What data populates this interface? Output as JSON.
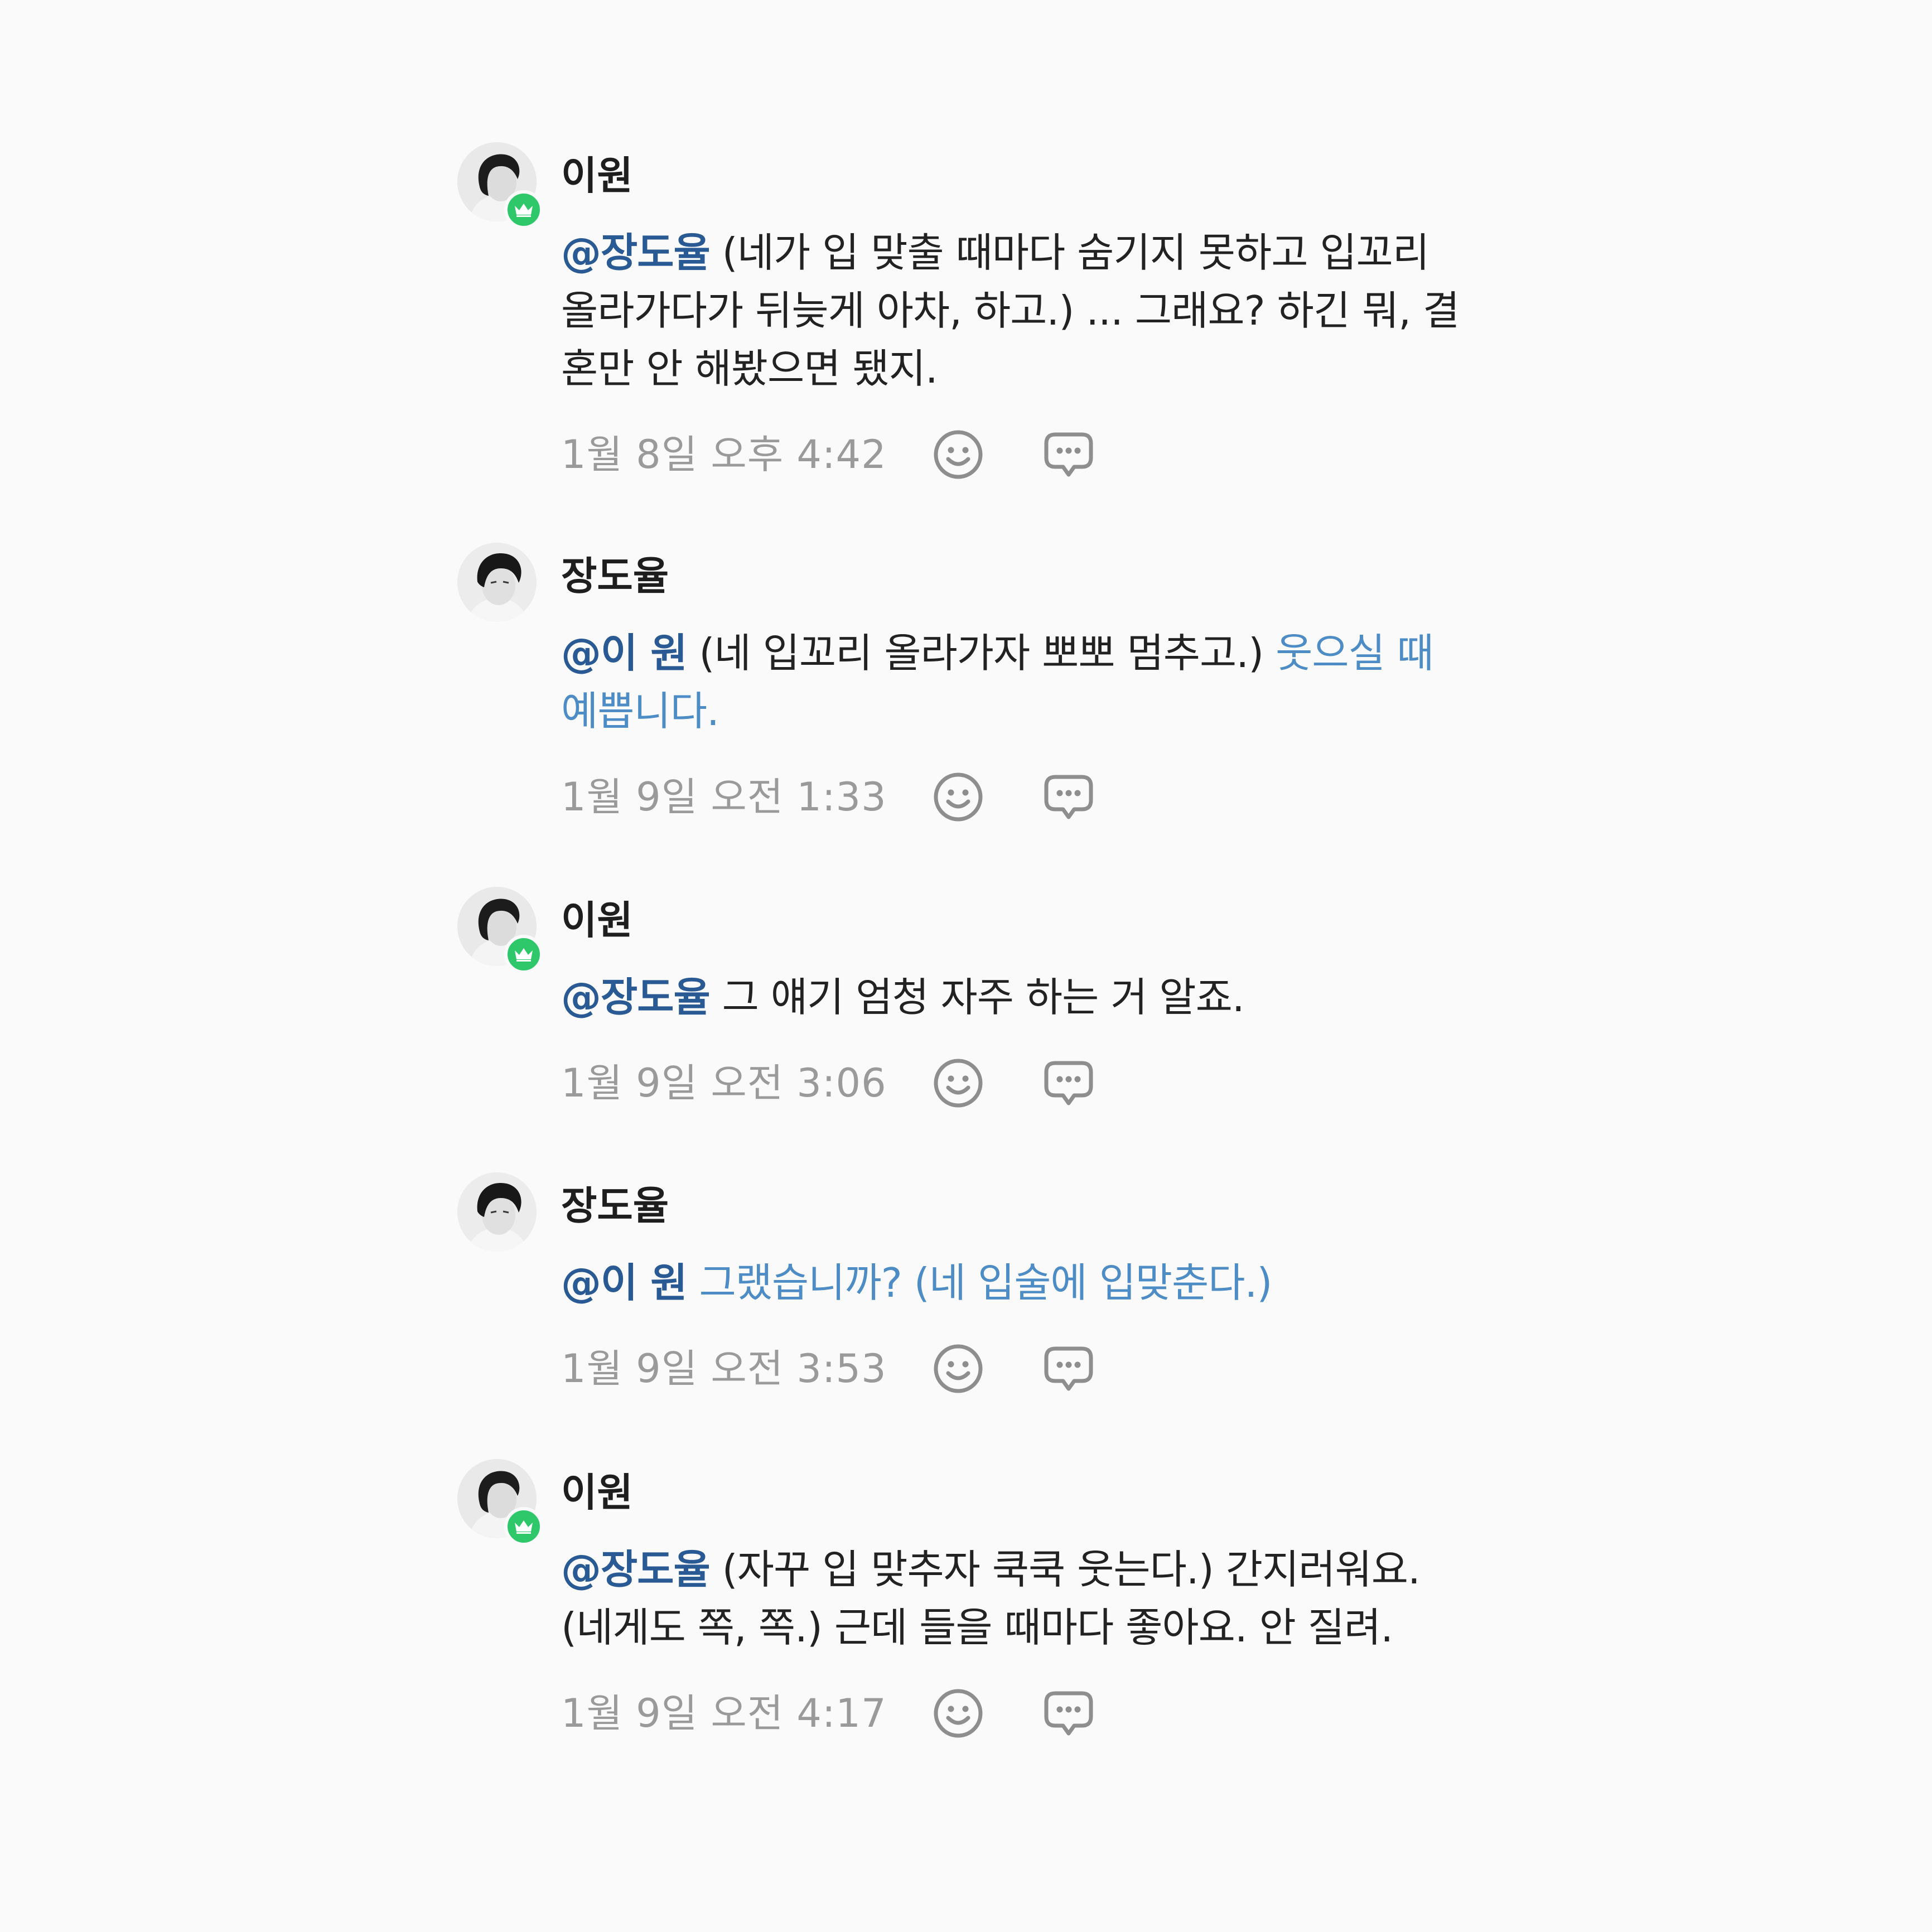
{
  "colors": {
    "background": "#fafafa",
    "mention": "#2a5a94",
    "highlight": "#4d8cc4",
    "timestamp": "#9a9a9a",
    "badge": "#2ec76a"
  },
  "comments": [
    {
      "author": "이원",
      "has_crown_badge": true,
      "mention": "@장도율",
      "text": " (네가 입 맞출 때마다 숨기지 못하고 입꼬리 올라가다가 뒤늦게 아차, 하고.) ... 그래요? 하긴 뭐, 결혼만 안 해봤으면 됐지.",
      "highlight": "",
      "timestamp": "1월 8일 오후 4:42"
    },
    {
      "author": "장도율",
      "has_crown_badge": false,
      "mention": "@이 원",
      "text": " (네 입꼬리 올라가자 뽀뽀 멈추고.) ",
      "highlight": "웃으실 때 예쁩니다.",
      "timestamp": "1월 9일 오전 1:33"
    },
    {
      "author": "이원",
      "has_crown_badge": true,
      "mention": "@장도율",
      "text": " 그 얘기 엄청 자주 하는 거 알죠.",
      "highlight": "",
      "timestamp": "1월 9일 오전 3:06"
    },
    {
      "author": "장도율",
      "has_crown_badge": false,
      "mention": "@이 원",
      "text": " ",
      "highlight": "그랬습니까? (네 입술에 입맞춘다.)",
      "timestamp": "1월 9일 오전 3:53"
    },
    {
      "author": "이원",
      "has_crown_badge": true,
      "mention": "@장도율",
      "text": " (자꾸 입 맞추자 쿡쿡 웃는다.) 간지러워요. (네게도 쪽, 쪽.) 근데 들을 때마다 좋아요. 안 질려.",
      "highlight": "",
      "timestamp": "1월 9일 오전 4:17"
    }
  ]
}
